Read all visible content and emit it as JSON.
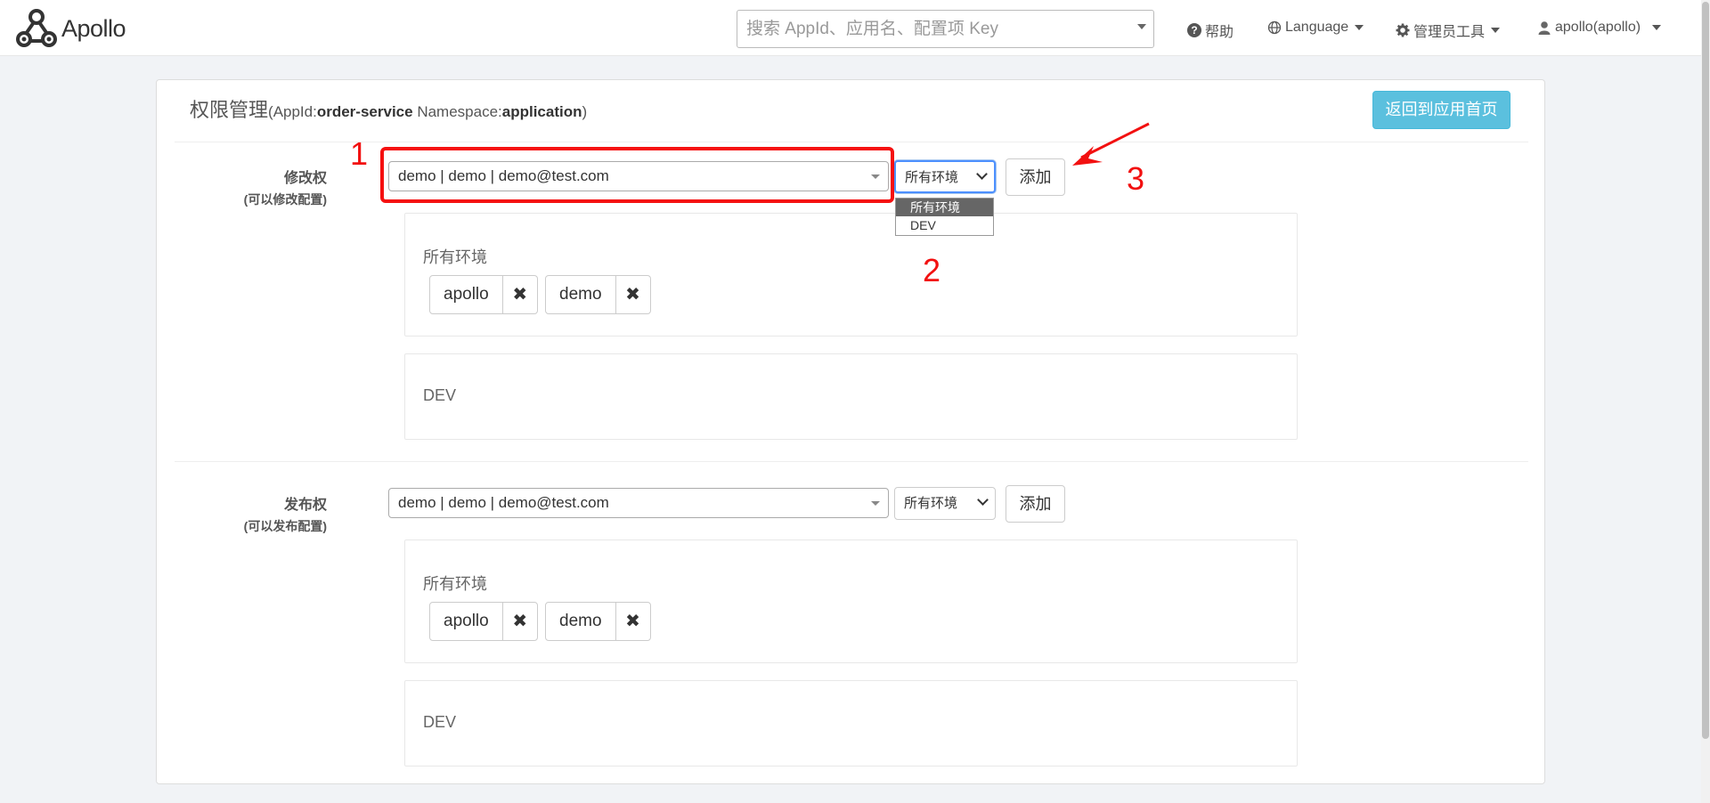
{
  "header": {
    "logo_text": "Apollo",
    "search_placeholder": "搜索 AppId、应用名、配置项 Key",
    "nav": {
      "help": "帮助",
      "language": "Language",
      "admin_tools": "管理员工具",
      "user": "apollo(apollo)"
    }
  },
  "page": {
    "title": "权限管理",
    "appid_label": "AppId:",
    "appid": "order-service",
    "namespace_label": "Namespace:",
    "namespace": "application",
    "back_button": "返回到应用首页"
  },
  "sections": [
    {
      "label": "修改权",
      "sublabel": "(可以修改配置)",
      "user_select": "demo | demo | demo@test.com",
      "env_select": "所有环境",
      "add_button": "添加",
      "env_blocks": [
        {
          "env": "所有环境",
          "users": [
            "apollo",
            "demo"
          ]
        },
        {
          "env": "DEV",
          "users": []
        }
      ]
    },
    {
      "label": "发布权",
      "sublabel": "(可以发布配置)",
      "user_select": "demo | demo | demo@test.com",
      "env_select": "所有环境",
      "add_button": "添加",
      "env_blocks": [
        {
          "env": "所有环境",
          "users": [
            "apollo",
            "demo"
          ]
        },
        {
          "env": "DEV",
          "users": []
        }
      ]
    }
  ],
  "env_dropdown": {
    "options": [
      "所有环境",
      "DEV"
    ],
    "selected": "所有环境"
  },
  "annotations": {
    "step1": "1",
    "step2": "2",
    "step3": "3",
    "color": "#f21010"
  },
  "icons": {
    "remove": "✖",
    "help": "?"
  },
  "colors": {
    "accent": "#5bc0de",
    "background": "#f1f3f6"
  }
}
